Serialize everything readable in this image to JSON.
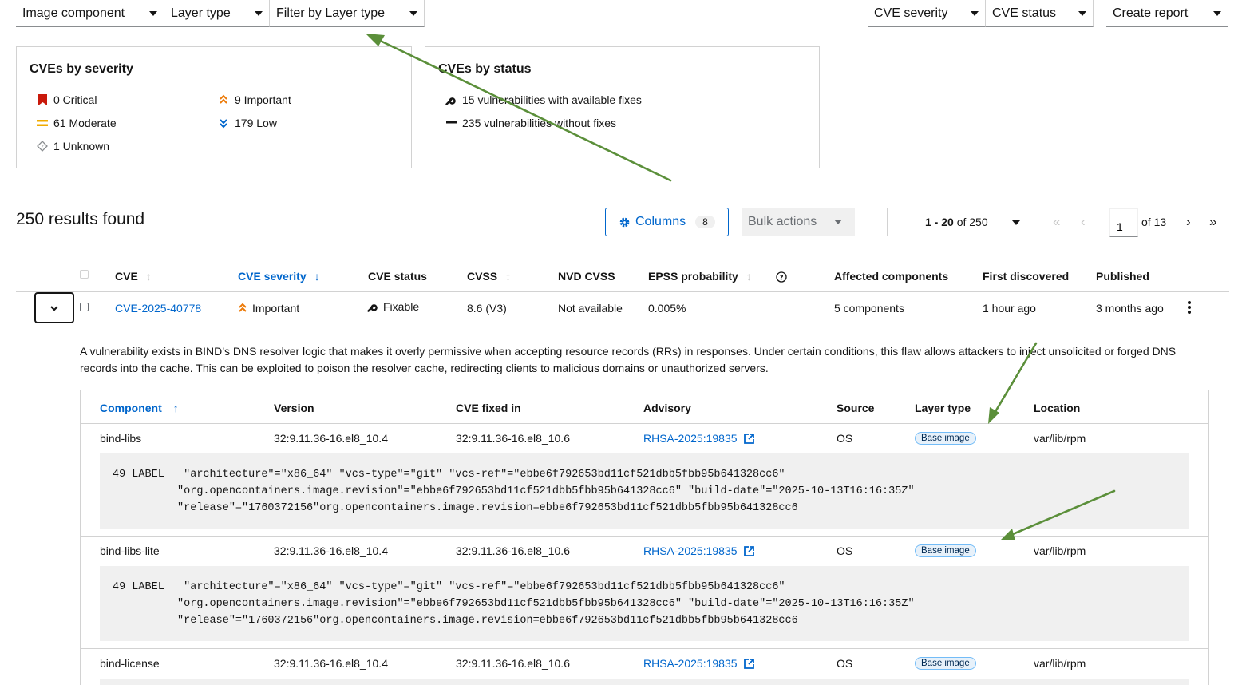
{
  "toolbar": {
    "filters_left": [
      {
        "label": "Image component"
      },
      {
        "label": "Layer type"
      },
      {
        "label": "Filter by Layer type"
      }
    ],
    "filters_right": [
      {
        "label": "CVE severity"
      },
      {
        "label": "CVE status"
      },
      {
        "label": "Create report"
      }
    ]
  },
  "severity_card": {
    "title": "CVEs by severity",
    "items": [
      {
        "label": "0 Critical",
        "icon": "critical-icon",
        "color": "#c9190b"
      },
      {
        "label": "9 Important",
        "icon": "important-icon",
        "color": "#ec7a08"
      },
      {
        "label": "61 Moderate",
        "icon": "moderate-icon",
        "color": "#f0ab00"
      },
      {
        "label": "179 Low",
        "icon": "low-icon",
        "color": "#0066cc"
      },
      {
        "label": "1 Unknown",
        "icon": "unknown-icon",
        "color": "#8a8d90"
      }
    ]
  },
  "status_card": {
    "title": "CVEs by status",
    "items": [
      {
        "label": "15 vulnerabilities with available fixes",
        "icon": "wrench-icon"
      },
      {
        "label": "235 vulnerabilities without fixes",
        "icon": "dash-icon"
      }
    ]
  },
  "results": {
    "label": "250 results found"
  },
  "columns_button": {
    "label": "Columns",
    "count": "8"
  },
  "bulk_actions": {
    "label": "Bulk actions"
  },
  "pagination": {
    "range_bold": "1 - 20",
    "range_rest": " of 250",
    "page": "1",
    "of_pages": "of 13"
  },
  "table": {
    "headers": [
      "CVE",
      "CVE severity",
      "CVE status",
      "CVSS",
      "NVD CVSS",
      "EPSS probability",
      "Affected components",
      "First discovered",
      "Published"
    ],
    "row": {
      "cve": "CVE-2025-40778",
      "severity": "Important",
      "status": "Fixable",
      "cvss": "8.6 (V3)",
      "nvd_cvss": "Not available",
      "epss": "0.005%",
      "affected": "5 components",
      "first_discovered": "1 hour ago",
      "published": "3 months ago"
    },
    "description": "A vulnerability exists in BIND’s DNS resolver logic that makes it overly permissive when accepting resource records (RRs) in responses. Under certain conditions, this flaw allows attackers to inject unsolicited or forged DNS records into the cache. This can be exploited to poison the resolver cache, redirecting clients to malicious domains or unauthorized servers."
  },
  "components": {
    "headers": [
      "Component",
      "Version",
      "CVE fixed in",
      "Advisory",
      "Source",
      "Layer type",
      "Location"
    ],
    "rows": [
      {
        "name": "bind-libs",
        "version": "32:9.11.36-16.el8_10.4",
        "fixed_in": "32:9.11.36-16.el8_10.6",
        "advisory": "RHSA-2025:19835",
        "source": "OS",
        "layer": "Base image",
        "location": "var/lib/rpm",
        "code": "49 LABEL   \"architecture\"=\"x86_64\" \"vcs-type\"=\"git\" \"vcs-ref\"=\"ebbe6f792653bd11cf521dbb5fbb95b641328cc6\"\n          \"org.opencontainers.image.revision\"=\"ebbe6f792653bd11cf521dbb5fbb95b641328cc6\" \"build-date\"=\"2025-10-13T16:16:35Z\"\n          \"release\"=\"1760372156\"org.opencontainers.image.revision=ebbe6f792653bd11cf521dbb5fbb95b641328cc6"
      },
      {
        "name": "bind-libs-lite",
        "version": "32:9.11.36-16.el8_10.4",
        "fixed_in": "32:9.11.36-16.el8_10.6",
        "advisory": "RHSA-2025:19835",
        "source": "OS",
        "layer": "Base image",
        "location": "var/lib/rpm",
        "code": "49 LABEL   \"architecture\"=\"x86_64\" \"vcs-type\"=\"git\" \"vcs-ref\"=\"ebbe6f792653bd11cf521dbb5fbb95b641328cc6\"\n          \"org.opencontainers.image.revision\"=\"ebbe6f792653bd11cf521dbb5fbb95b641328cc6\" \"build-date\"=\"2025-10-13T16:16:35Z\"\n          \"release\"=\"1760372156\"org.opencontainers.image.revision=ebbe6f792653bd11cf521dbb5fbb95b641328cc6"
      },
      {
        "name": "bind-license",
        "version": "32:9.11.36-16.el8_10.4",
        "fixed_in": "32:9.11.36-16.el8_10.6",
        "advisory": "RHSA-2025:19835",
        "source": "OS",
        "layer": "Base image",
        "location": "var/lib/rpm"
      }
    ]
  },
  "colors": {
    "link": "#0066cc",
    "annotation_arrow": "#5b8f3a"
  }
}
